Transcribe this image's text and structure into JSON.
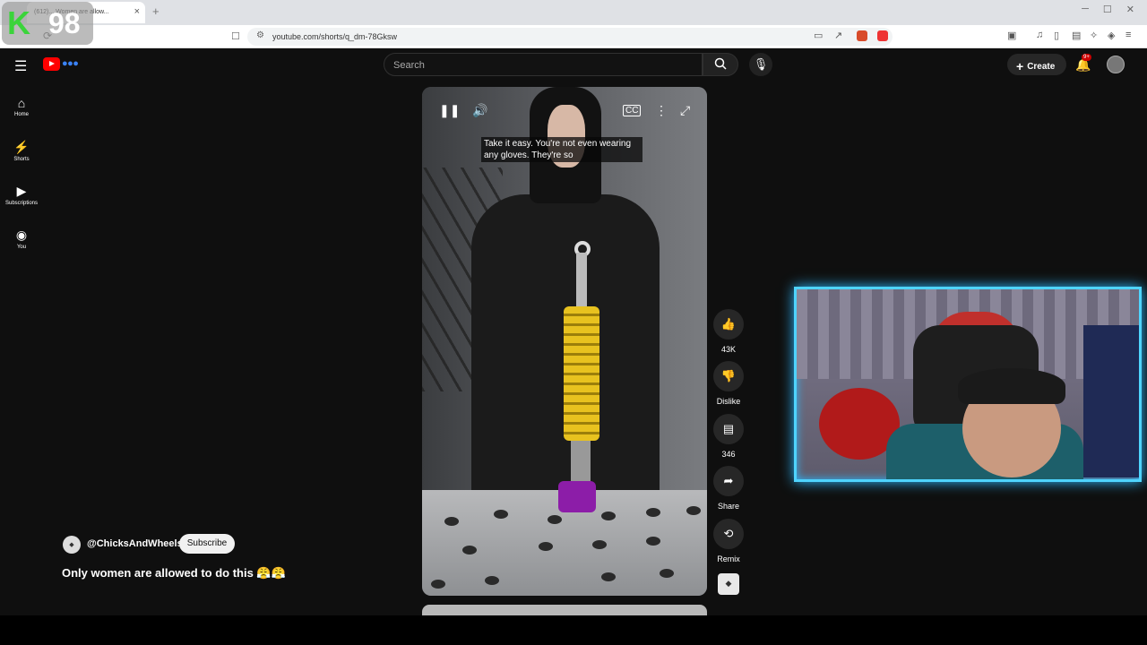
{
  "browser": {
    "tab_title": "(612)... Women are allow...",
    "tab_close": "×",
    "new_tab": "+",
    "url": "youtube.com/shorts/q_dm-78Gksw"
  },
  "overlay": {
    "letter": "K",
    "number": "98"
  },
  "header": {
    "search_placeholder": "Search",
    "create_label": "Create",
    "notification_badge": "9+"
  },
  "sidebar": {
    "items": [
      {
        "label": "Home",
        "icon": "home-icon"
      },
      {
        "label": "Shorts",
        "icon": "shorts-icon"
      },
      {
        "label": "Subscriptions",
        "icon": "subscriptions-icon"
      },
      {
        "label": "You",
        "icon": "you-icon"
      }
    ]
  },
  "video": {
    "caption": "Take it easy. You're not even wearing any gloves. They're so"
  },
  "actions": {
    "like_count": "43K",
    "dislike_label": "Dislike",
    "comment_count": "346",
    "share_label": "Share",
    "remix_label": "Remix"
  },
  "channel": {
    "handle": "@ChicksAndWheels",
    "subscribe_label": "Subscribe",
    "title": "Only women are allowed to do this 😤😤"
  },
  "colors": {
    "youtube_red": "#ff0000",
    "webcam_border": "#4fd4ff",
    "spring_yellow": "#e8c21f",
    "overlay_green": "#3bd43b"
  }
}
